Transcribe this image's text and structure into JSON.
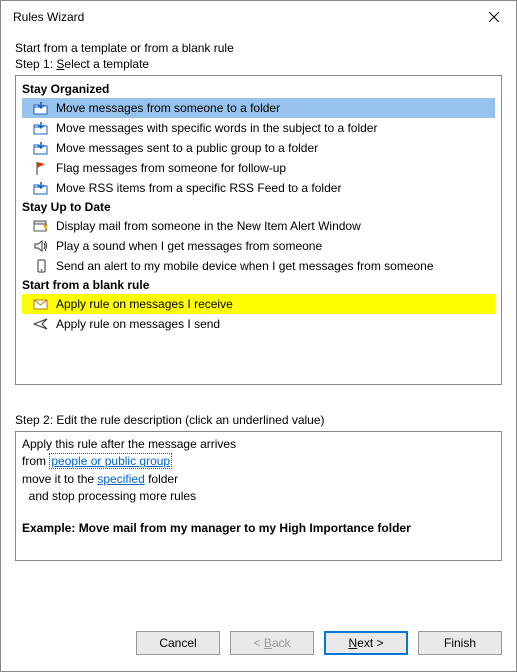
{
  "titlebar": {
    "title": "Rules Wizard"
  },
  "intro": "Start from a template or from a blank rule",
  "step1": {
    "prefix": "Step 1: ",
    "s": "S",
    "rest": "elect a template"
  },
  "groups": {
    "organized": {
      "header": "Stay Organized",
      "items": [
        "Move messages from someone to a folder",
        "Move messages with specific words in the subject to a folder",
        "Move messages sent to a public group to a folder",
        "Flag messages from someone for follow-up",
        "Move RSS items from a specific RSS Feed to a folder"
      ]
    },
    "uptodate": {
      "header": "Stay Up to Date",
      "items": [
        "Display mail from someone in the New Item Alert Window",
        "Play a sound when I get messages from someone",
        "Send an alert to my mobile device when I get messages from someone"
      ]
    },
    "blank": {
      "header": "Start from a blank rule",
      "items": [
        "Apply rule on messages I receive",
        "Apply rule on messages I send"
      ]
    }
  },
  "step2": {
    "label": "Step 2: Edit the rule description (click an underlined value)",
    "line1": "Apply this rule after the message arrives",
    "line2_prefix": "from ",
    "line2_link": "people or public group",
    "line3_prefix": "move it to the ",
    "line3_link": "specified",
    "line3_suffix": " folder",
    "line4": "  and stop processing more rules",
    "example": "Example: Move mail from my manager to my High Importance folder"
  },
  "buttons": {
    "cancel": "Cancel",
    "back_prefix": "< ",
    "back_b": "B",
    "back_rest": "ack",
    "next_n": "N",
    "next_rest": "ext >",
    "finish": "Finish"
  }
}
